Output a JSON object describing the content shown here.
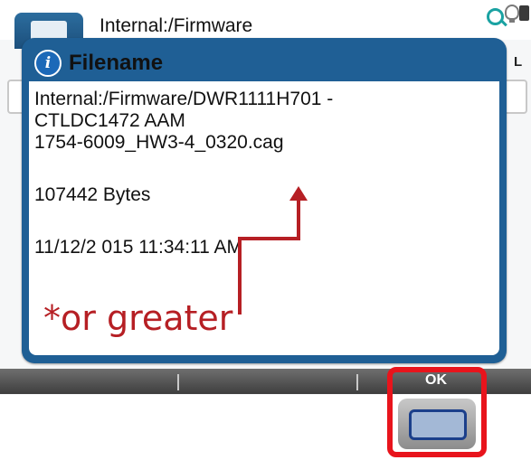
{
  "header": {
    "path_title": "Internal:/Firmware"
  },
  "dialog": {
    "title": "Filename",
    "path_line1": "Internal:/Firmware/DWR1111H701 -",
    "path_line2": "CTLDC1472 AAM",
    "path_line3": "1754-6009_HW3-4_0320.cag",
    "size": "107442 Bytes",
    "timestamp": "11/12/2 015 11:34:11 AM"
  },
  "annotation": {
    "text": "*or greater",
    "color": "#b61f24"
  },
  "background": {
    "partial_label": "L"
  },
  "softkeys": {
    "ok_label": "OK"
  },
  "colors": {
    "dialog_frame": "#1f5f95",
    "callout": "#e8141c",
    "softkey_bar": "#4a4a4a"
  },
  "icons": [
    "info-icon",
    "search-icon",
    "bulb-icon",
    "calculator-icon",
    "folder-icon"
  ]
}
